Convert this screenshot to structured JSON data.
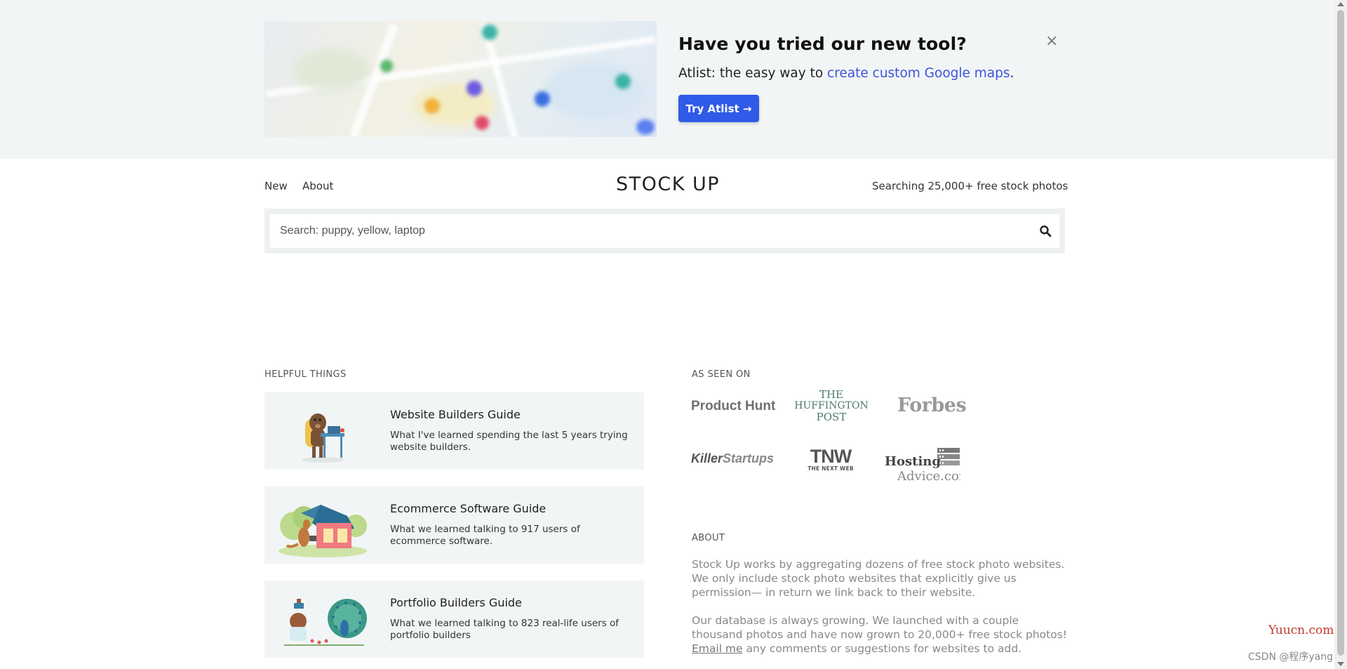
{
  "promo": {
    "title": "Have you tried our new tool?",
    "text_before": "Atlist: the easy way to ",
    "link": "create custom Google maps",
    "text_after": ".",
    "button": "Try Atlist →",
    "close": "×"
  },
  "header": {
    "nav": [
      "New",
      "About"
    ],
    "logo": "STOCK UP",
    "tagline": "Searching 25,000+ free stock photos"
  },
  "search": {
    "placeholder": "Search: puppy, yellow, laptop",
    "icon": "search-icon"
  },
  "helpful": {
    "label": "HELPFUL THINGS",
    "cards": [
      {
        "title": "Website Builders Guide",
        "desc": "What I've learned spending the last 5 years trying website builders."
      },
      {
        "title": "Ecommerce Software Guide",
        "desc": "What we learned talking to 917 users of ecommerce software."
      },
      {
        "title": "Portfolio Builders Guide",
        "desc": "What we learned talking to 823 real-life users of portfolio builders"
      }
    ]
  },
  "press": {
    "label": "AS SEEN ON",
    "logos": {
      "product_hunt": "Product Hunt",
      "huffington_1": "THE",
      "huffington_2": "HUFFINGTON",
      "huffington_3": "POST",
      "forbes": "Forbes",
      "killer_1": "Killer",
      "killer_2": "Startups",
      "tnw_1": "TNW",
      "tnw_2": "THE NEXT WEB",
      "hosting_1": "Hosting",
      "hosting_2": "Advice.cor"
    }
  },
  "about": {
    "label": "ABOUT",
    "para1": "Stock Up works by aggregating dozens of free stock photo websites. We only include stock photo websites that explicitly give us permission— in return we link back to their website.",
    "para2": "Our database is always growing. We launched with a couple thousand photos and have now grown to 20,000+ free stock photos!",
    "email_link": "Email me",
    "para2_after": " any comments or suggestions for websites to add."
  },
  "watermark": {
    "domain": "Yuucn.com",
    "csdn": "CSDN @程序yang"
  },
  "colors": {
    "accent": "#2f5be8",
    "link": "#3b53e0",
    "panel": "#f2f5f5"
  }
}
